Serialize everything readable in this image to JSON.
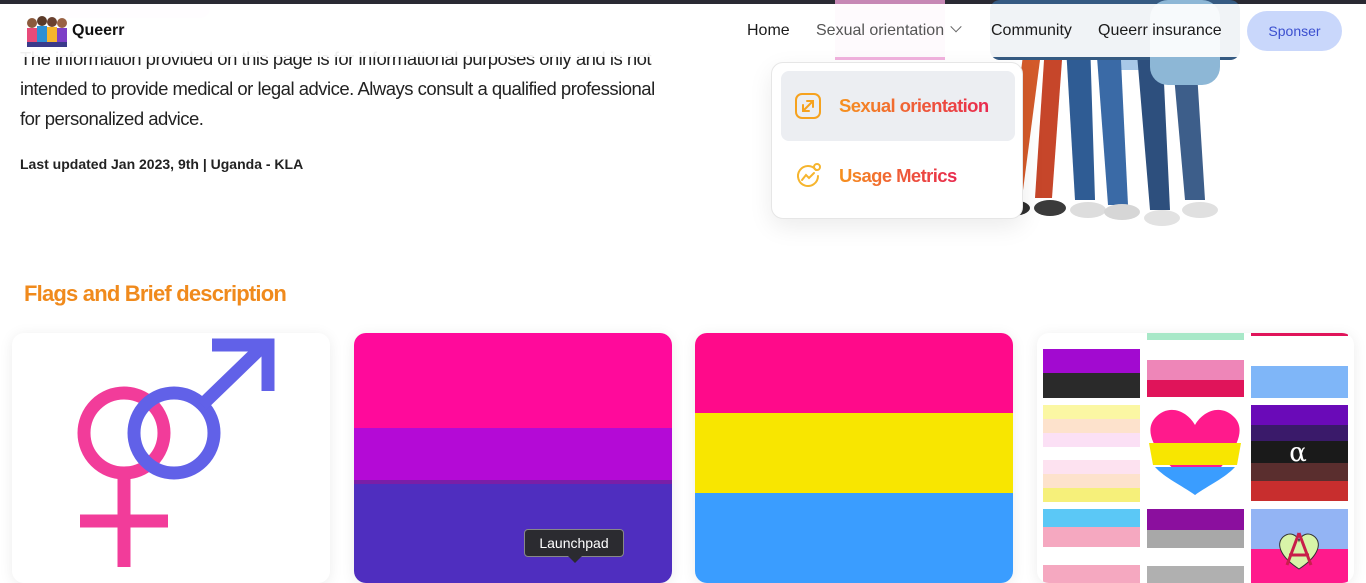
{
  "navbar": {
    "brand": "Queerr",
    "links": {
      "home": "Home",
      "sexual_orientation": "Sexual orientation",
      "community": "Community",
      "insurance": "Queerr insurance"
    },
    "sponsor_label": "Sponser"
  },
  "content": {
    "disclaimer": "The information provided on this page is for informational purposes only and is not intended to provide medical or legal advice. Always consult a qualified professional for personalized advice.",
    "last_updated": "Last updated Jan 2023, 9th | Uganda - KLA"
  },
  "dropdown": {
    "items": [
      {
        "label": "Sexual orientation",
        "icon": "expand-arrows-icon",
        "active": true
      },
      {
        "label": "Usage Metrics",
        "icon": "chart-trend-icon",
        "active": false
      }
    ]
  },
  "flags_section": {
    "title": "Flags and Brief description",
    "cards": [
      {
        "name": "heterosexual-symbol",
        "colors": [
          "#f23c9a",
          "#6161e8"
        ]
      },
      {
        "name": "bisexual-flag",
        "colors": [
          "#ff0a9b",
          "#b40ad6",
          "#4f2ebf"
        ]
      },
      {
        "name": "pansexual-flag",
        "colors": [
          "#ff0a8a",
          "#f8e600",
          "#3a9dff"
        ]
      },
      {
        "name": "flag-collage",
        "alpha_glyph": "α"
      }
    ]
  },
  "tooltip": {
    "text": "Launchpad"
  },
  "colors": {
    "accent_orange": "#f08a1c",
    "accent_red": "#e8294f",
    "sponsor_bg": "#c9d7fb",
    "sponsor_text": "#3b4fcf"
  }
}
